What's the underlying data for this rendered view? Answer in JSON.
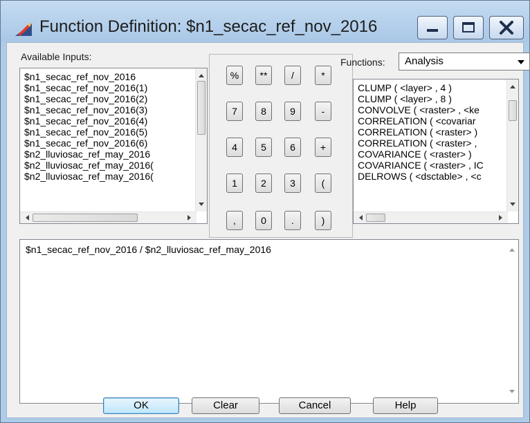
{
  "window": {
    "title": "Function Definition:  $n1_secac_ref_nov_2016"
  },
  "inputs": {
    "label": "Available Inputs:",
    "items": [
      "$n1_secac_ref_nov_2016",
      "$n1_secac_ref_nov_2016(1)",
      "$n1_secac_ref_nov_2016(2)",
      "$n1_secac_ref_nov_2016(3)",
      "$n1_secac_ref_nov_2016(4)",
      "$n1_secac_ref_nov_2016(5)",
      "$n1_secac_ref_nov_2016(6)",
      "$n2_lluviosac_ref_may_2016",
      "$n2_lluviosac_ref_may_2016(",
      "$n2_lluviosac_ref_may_2016("
    ]
  },
  "calculator": {
    "keys": [
      [
        "%",
        "**",
        "/",
        "*"
      ],
      [
        "7",
        "8",
        "9",
        "-"
      ],
      [
        "4",
        "5",
        "6",
        "+"
      ],
      [
        "1",
        "2",
        "3",
        "("
      ],
      [
        ",",
        "0",
        ".",
        ")"
      ]
    ]
  },
  "functions": {
    "label": "Functions:",
    "category": "Analysis",
    "items": [
      "CLUMP ( <layer> , 4 )",
      "CLUMP ( <layer> , 8 )",
      "CONVOLVE ( <raster> , <ke",
      "CORRELATION ( <covariar",
      "CORRELATION ( <raster> )",
      "CORRELATION ( <raster> ,",
      "COVARIANCE ( <raster> )",
      "COVARIANCE ( <raster> , IC",
      "DELROWS ( <dsctable> , <c"
    ]
  },
  "expression": {
    "text": "$n1_secac_ref_nov_2016 / $n2_lluviosac_ref_may_2016"
  },
  "buttons": {
    "ok": "OK",
    "clear": "Clear",
    "cancel": "Cancel",
    "help": "Help"
  },
  "colors": {
    "titlebar": "#aecbe8",
    "dialog": "#f0f0f0",
    "default_button": "#bee6fd"
  }
}
